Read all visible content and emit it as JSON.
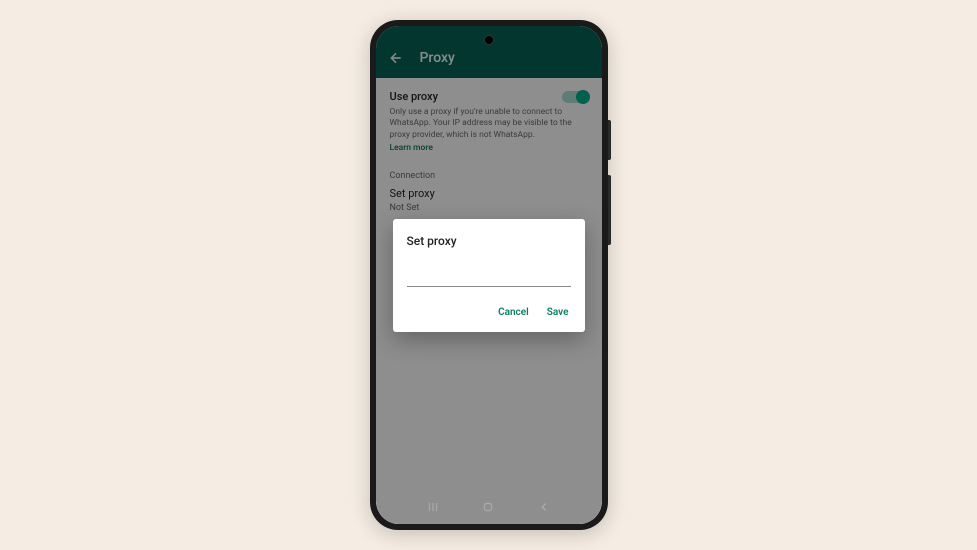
{
  "header": {
    "title": "Proxy"
  },
  "settings": {
    "use_proxy": {
      "title": "Use proxy",
      "description": "Only use a proxy if you're unable to connect to WhatsApp. Your IP address may be visible to the proxy provider, which is not WhatsApp.",
      "learn_more": "Learn more",
      "enabled": true
    },
    "connection": {
      "section_label": "Connection",
      "set_proxy_label": "Set proxy",
      "status": "Not Set"
    }
  },
  "dialog": {
    "title": "Set proxy",
    "input_value": "",
    "cancel": "Cancel",
    "save": "Save"
  }
}
